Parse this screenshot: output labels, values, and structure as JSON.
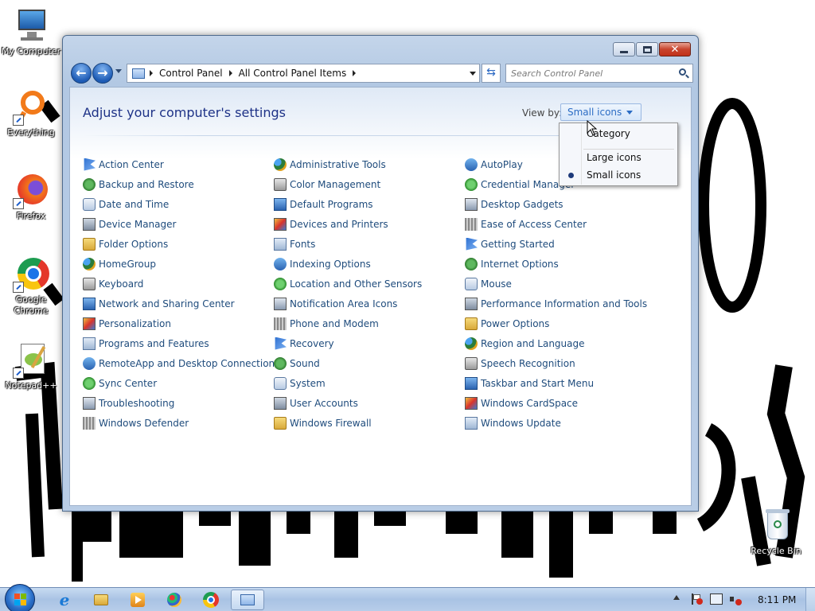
{
  "desktop": {
    "icons": [
      {
        "label": "My Computer"
      },
      {
        "label": "Everything"
      },
      {
        "label": "Firefox"
      },
      {
        "label": "Google Chrome"
      },
      {
        "label": "Notepad++"
      },
      {
        "label": "Recycle Bin"
      }
    ]
  },
  "window": {
    "breadcrumb": [
      "Control Panel",
      "All Control Panel Items"
    ],
    "search_placeholder": "Search Control Panel",
    "title": "Adjust your computer's settings",
    "viewby_label": "View by:",
    "viewby_value": "Small icons"
  },
  "menu": {
    "items": [
      "Category",
      "Large icons",
      "Small icons"
    ],
    "selected": "Small icons"
  },
  "columns": [
    [
      "Action Center",
      "Backup and Restore",
      "Date and Time",
      "Device Manager",
      "Folder Options",
      "HomeGroup",
      "Keyboard",
      "Network and Sharing Center",
      "Personalization",
      "Programs and Features",
      "RemoteApp and Desktop Connections",
      "Sync Center",
      "Troubleshooting",
      "Windows Defender"
    ],
    [
      "Administrative Tools",
      "Color Management",
      "Default Programs",
      "Devices and Printers",
      "Fonts",
      "Indexing Options",
      "Location and Other Sensors",
      "Notification Area Icons",
      "Phone and Modem",
      "Recovery",
      "Sound",
      "System",
      "User Accounts",
      "Windows Firewall"
    ],
    [
      "AutoPlay",
      "Credential Manager",
      "Desktop Gadgets",
      "Ease of Access Center",
      "Getting Started",
      "Internet Options",
      "Mouse",
      "Performance Information and Tools",
      "Power Options",
      "Region and Language",
      "Speech Recognition",
      "Taskbar and Start Menu",
      "Windows CardSpace",
      "Windows Update"
    ]
  ],
  "taskbar": {
    "clock": "8:11 PM"
  },
  "colors": {
    "link": "#1e4b7c",
    "title": "#1e3287",
    "accent": "#2b6cc4"
  }
}
